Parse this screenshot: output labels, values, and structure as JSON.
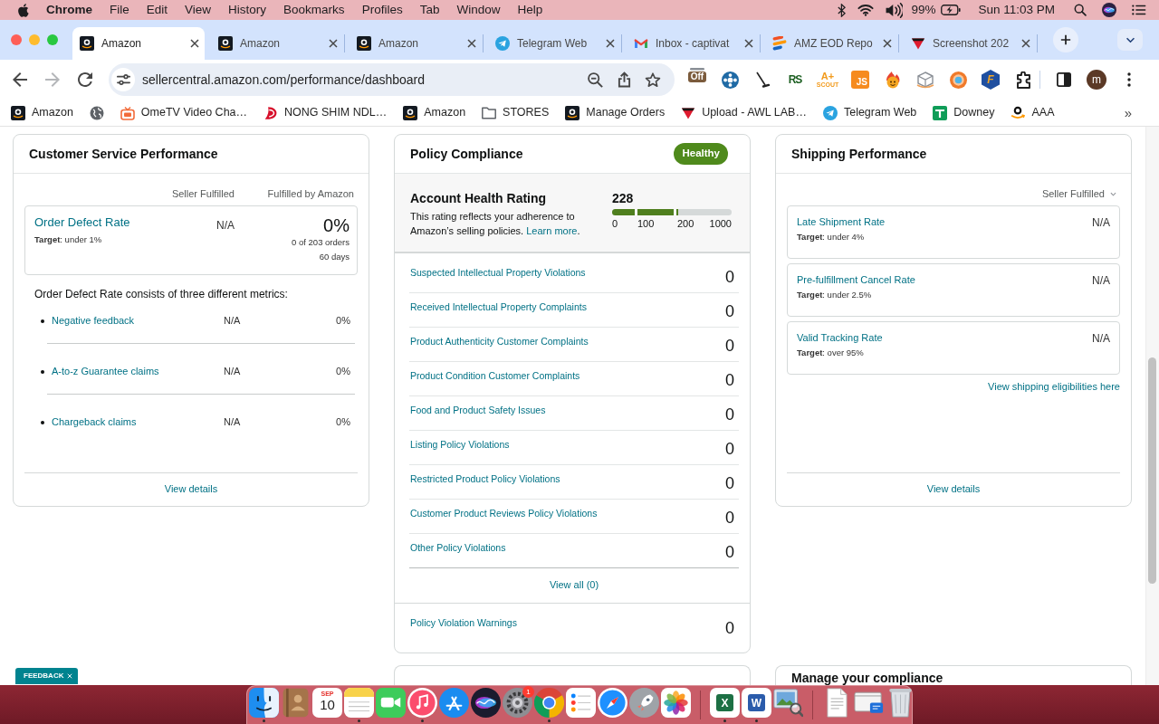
{
  "menu_bar": {
    "app": "Chrome",
    "menus": [
      "File",
      "Edit",
      "View",
      "History",
      "Bookmarks",
      "Profiles",
      "Tab",
      "Window",
      "Help"
    ],
    "battery": "99%",
    "clock": "Sun 11:03 PM"
  },
  "tabs": [
    {
      "kind": "amazon",
      "title": "Amazon",
      "selected": true
    },
    {
      "kind": "amazon",
      "title": "Amazon",
      "selected": false
    },
    {
      "kind": "amazon",
      "title": "Amazon",
      "selected": false
    },
    {
      "kind": "telegram",
      "title": "Telegram Web",
      "selected": false
    },
    {
      "kind": "mail",
      "title": "Inbox - captivat",
      "selected": false
    },
    {
      "kind": "stripes",
      "title": "AMZ EOD Repo",
      "selected": false
    },
    {
      "kind": "triangle",
      "title": "Screenshot 202",
      "selected": false
    }
  ],
  "toolbar": {
    "forward_disabled": true,
    "address": "sellercentral.amazon.com/performance/dashboard",
    "extensions": [
      {
        "kind": "badge",
        "badge": "Off"
      },
      {
        "kind": "wheel"
      },
      {
        "kind": "broom"
      },
      {
        "kind": "letters",
        "text": "RS"
      },
      {
        "kind": "scout",
        "text": "A+",
        "subtext": "SCOUT"
      },
      {
        "kind": "tile",
        "text": "JS"
      },
      {
        "kind": "flame"
      },
      {
        "kind": "cube"
      },
      {
        "kind": "orb"
      },
      {
        "kind": "hexagon",
        "text": "F"
      },
      {
        "kind": "puzzle"
      }
    ],
    "profile_initial": "m"
  },
  "bookmarks": {
    "items": [
      {
        "kind": "amazon",
        "label": "Amazon"
      },
      {
        "kind": "globe"
      },
      {
        "kind": "tv",
        "label": "OmeTV Video Cha…"
      },
      {
        "kind": "swoosh",
        "label": "NONG SHIM NDL…"
      },
      {
        "kind": "amazon",
        "label": "Amazon"
      },
      {
        "kind": "folder",
        "label": "STORES"
      },
      {
        "kind": "amazon",
        "label": "Manage Orders"
      },
      {
        "kind": "triangle",
        "label": "Upload - AWL LAB…"
      },
      {
        "kind": "telegram",
        "label": "Telegram Web"
      },
      {
        "kind": "sheet",
        "label": "Downey"
      },
      {
        "kind": "smile",
        "label": "AAA"
      }
    ],
    "more": "»"
  },
  "customer_service": {
    "title": "Customer Service Performance",
    "columns": [
      "Seller Fulfilled",
      "Fulfilled by Amazon"
    ],
    "order_defect_rate": {
      "label": "Order Defect Rate",
      "target": "**Target**: under 1%",
      "seller_fulfilled": "N/A",
      "fulfilled_by_amazon": "0%",
      "orders": "0 of 203 orders",
      "period": "60 days"
    },
    "intro": "Order Defect Rate consists of three different metrics:",
    "metrics": [
      {
        "label": "Negative feedback",
        "seller_fulfilled": "N/A",
        "fulfilled_by_amazon": "0%"
      },
      {
        "label": "A-to-z Guarantee claims",
        "seller_fulfilled": "N/A",
        "fulfilled_by_amazon": "0%"
      },
      {
        "label": "Chargeback claims",
        "seller_fulfilled": "N/A",
        "fulfilled_by_amazon": "0%"
      }
    ],
    "footer_link": "View details"
  },
  "policy_compliance": {
    "title": "Policy Compliance",
    "status": "Healthy",
    "rating": {
      "title": "Account Health Rating",
      "description": "This rating reflects your adherence to Amazon’s selling policies.",
      "link": "Learn more",
      "link_after": ".",
      "score": "228",
      "level": 0.55,
      "ticks": [
        "0",
        "100",
        "200",
        "1000"
      ]
    },
    "violations": [
      {
        "label": "Suspected Intellectual Property Violations",
        "count": "0"
      },
      {
        "label": "Received Intellectual Property Complaints",
        "count": "0"
      },
      {
        "label": "Product Authenticity Customer Complaints",
        "count": "0"
      },
      {
        "label": "Product Condition Customer Complaints",
        "count": "0"
      },
      {
        "label": "Food and Product Safety Issues",
        "count": "0"
      },
      {
        "label": "Listing Policy Violations",
        "count": "0"
      },
      {
        "label": "Restricted Product Policy Violations",
        "count": "0"
      },
      {
        "label": "Customer Product Reviews Policy Violations",
        "count": "0"
      },
      {
        "label": "Other Policy Violations",
        "count": "0"
      }
    ],
    "view_all": "View all (0)",
    "warnings": {
      "label": "Policy Violation Warnings",
      "count": "0"
    }
  },
  "shipping": {
    "title": "Shipping Performance",
    "filter": "Seller Fulfilled",
    "metrics": [
      {
        "label": "Late Shipment Rate",
        "target": "**Target**: under 4%",
        "value": "N/A"
      },
      {
        "label": "Pre-fulfillment Cancel Rate",
        "target": "**Target**: under 2.5%",
        "value": "N/A"
      },
      {
        "label": "Valid Tracking Rate",
        "target": "**Target**: over 95%",
        "value": "N/A"
      }
    ],
    "eligibility_link": "View shipping eligibilities here",
    "footer_link": "View details"
  },
  "compliance_card": {
    "title": "Manage your compliance"
  },
  "feedback": {
    "label": "FEEDBACK"
  },
  "dock": [
    {
      "kind": "finder",
      "running": true
    },
    {
      "kind": "contacts",
      "running": false
    },
    {
      "kind": "calendar",
      "month": "SEP",
      "day": "10",
      "running": false
    },
    {
      "kind": "notes",
      "running": true
    },
    {
      "kind": "facetime",
      "running": false
    },
    {
      "kind": "music",
      "running": true
    },
    {
      "kind": "appstore",
      "running": false
    },
    {
      "kind": "siri",
      "running": false
    },
    {
      "kind": "settings",
      "badge": "1",
      "running": false
    },
    {
      "kind": "chrome",
      "running": true
    },
    {
      "kind": "reminders",
      "running": false
    },
    {
      "kind": "safari",
      "running": false
    },
    {
      "kind": "launchpad",
      "running": false
    },
    {
      "kind": "photos",
      "running": false
    },
    {
      "kind": "separator"
    },
    {
      "kind": "excel",
      "text": "X",
      "running": true
    },
    {
      "kind": "word",
      "text": "W",
      "running": true
    },
    {
      "kind": "preview",
      "running": false
    },
    {
      "kind": "separator"
    },
    {
      "kind": "document",
      "running": false
    },
    {
      "kind": "window",
      "running": false
    },
    {
      "kind": "trash",
      "running": false
    }
  ]
}
